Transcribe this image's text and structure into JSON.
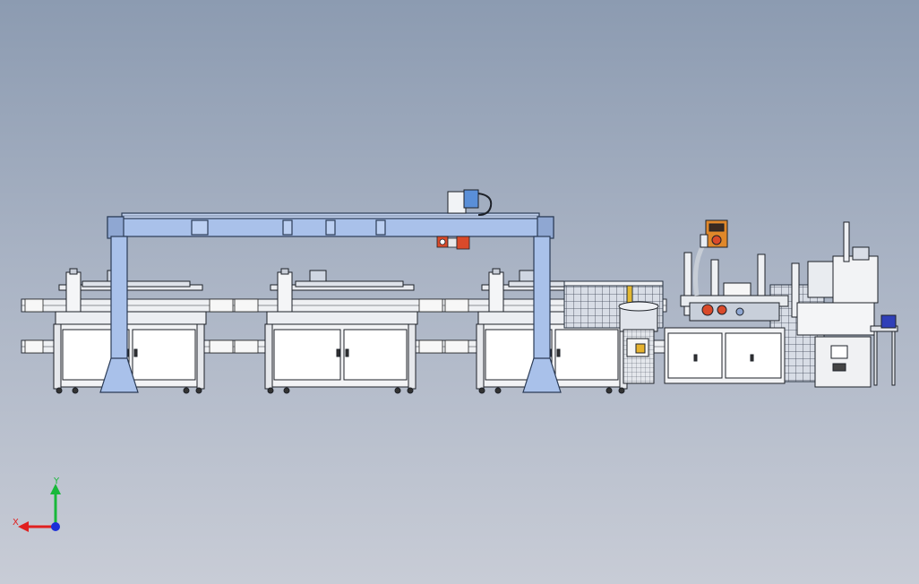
{
  "viewport": {
    "background_top": "#8c9bb1",
    "background_bottom": "#c8ccd6"
  },
  "model": {
    "gantry_color": "#a9c1ea",
    "gantry_outline": "#2b3b56",
    "cabinet_color": "#f2f3f5",
    "robot_color": "#d94a2a",
    "parts_bin_color": "#2f3fb8"
  },
  "triad": {
    "x_label": "X",
    "y_label": "Y",
    "x_color": "#e02020",
    "y_color": "#18b83a",
    "z_color": "#1c2fd8"
  }
}
